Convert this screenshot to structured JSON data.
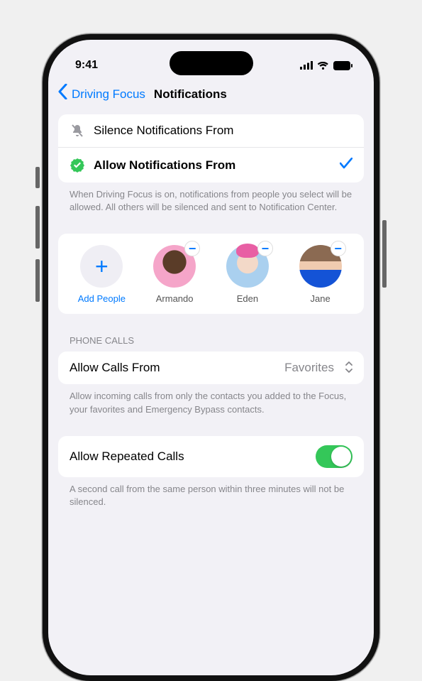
{
  "status": {
    "time": "9:41"
  },
  "nav": {
    "back": "Driving Focus",
    "title": "Notifications"
  },
  "mode": {
    "silence": "Silence Notifications From",
    "allow": "Allow Notifications From",
    "footer": "When Driving Focus is on, notifications from people you select will be allowed. All others will be silenced and sent to Notification Center."
  },
  "people": {
    "add": "Add People",
    "list": [
      {
        "name": "Armando"
      },
      {
        "name": "Eden"
      },
      {
        "name": "Jane"
      }
    ]
  },
  "calls": {
    "header": "Phone Calls",
    "allowFrom": {
      "label": "Allow Calls From",
      "value": "Favorites"
    },
    "footer": "Allow incoming calls from only the contacts you added to the Focus, your favorites and Emergency Bypass contacts.",
    "repeated": {
      "label": "Allow Repeated Calls",
      "on": true
    },
    "repeatedFooter": "A second call from the same person within three minutes will not be silenced."
  }
}
